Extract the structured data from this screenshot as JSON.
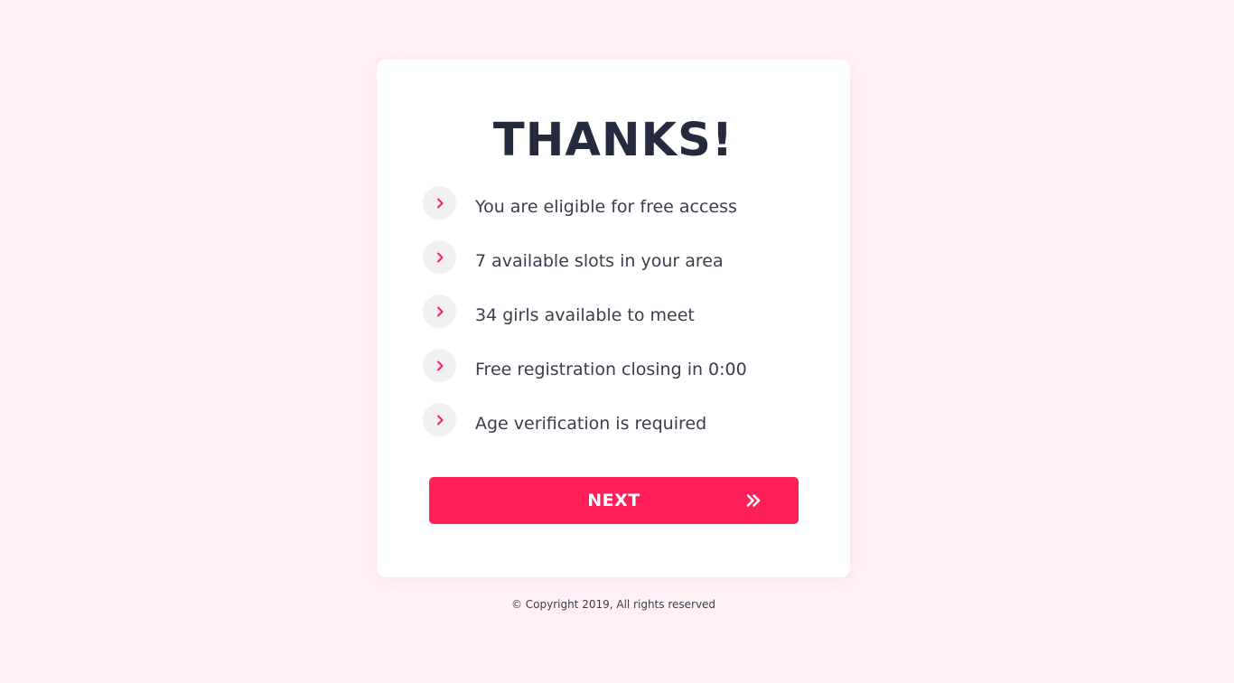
{
  "card": {
    "title": "THANKS!",
    "items": [
      {
        "icon": "chevron-right-icon",
        "text": "You are eligible for free access"
      },
      {
        "icon": "chevron-right-icon",
        "text": "7 available slots in your area"
      },
      {
        "icon": "chevron-right-icon",
        "text": "34 girls available to meet"
      },
      {
        "icon": "chevron-right-icon",
        "text": "Free registration closing in 0:00"
      },
      {
        "icon": "chevron-right-icon",
        "text": "Age verification is required"
      }
    ],
    "next_button": {
      "label": "NEXT",
      "icon": "double-chevron-right-icon"
    }
  },
  "footer": {
    "copyright": "© Copyright 2019, All rights reserved"
  },
  "colors": {
    "background": "#fff1f5",
    "card": "#ffffff",
    "accent": "#ff1f58",
    "title": "#262a3e",
    "text": "#3b3d4d",
    "icon_circle": "#f1eff1"
  }
}
